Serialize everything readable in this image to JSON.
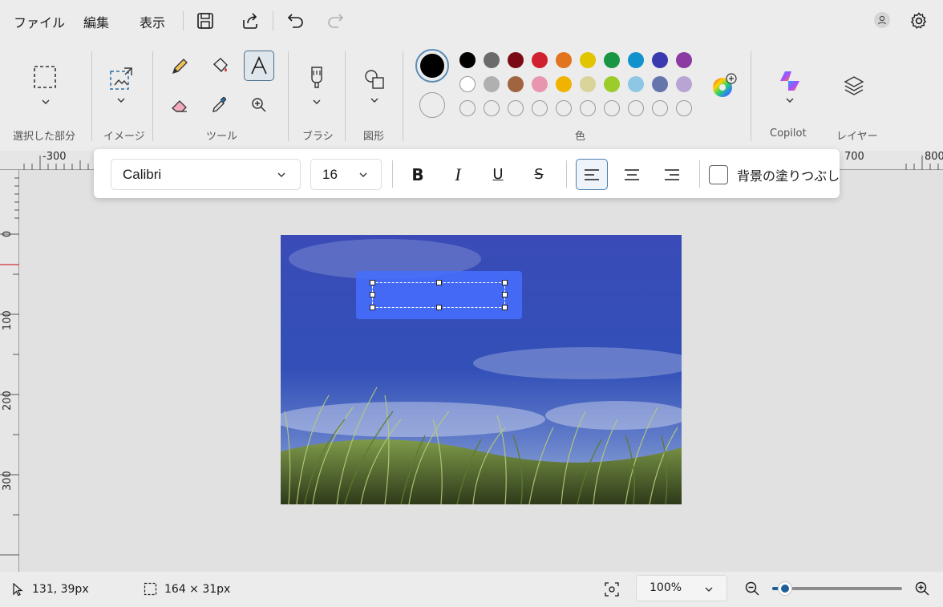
{
  "menu": {
    "file": "ファイル",
    "edit": "編集",
    "view": "表示"
  },
  "ribbon": {
    "selection_label": "選択した部分",
    "image_label": "イメージ",
    "tools_label": "ツール",
    "brush_label": "ブラシ",
    "shapes_label": "図形",
    "color_label": "色",
    "copilot_label": "Copilot",
    "layers_label": "レイヤー"
  },
  "colors": {
    "primary": "#000000",
    "secondary": "#ffffff",
    "palette_row1": [
      "#000000",
      "#6b6b6b",
      "#7a0b14",
      "#d1202f",
      "#e2731f",
      "#e3c400",
      "#1a9642",
      "#1292cc",
      "#3a3ab0",
      "#8a3aa0"
    ],
    "palette_row2": [
      "#ffffff",
      "#b0b0b0",
      "#a06540",
      "#e896b0",
      "#f0b300",
      "#d8d49a",
      "#9ccc2a",
      "#8ec7e3",
      "#6676ad",
      "#b8a5d3"
    ]
  },
  "rulers": {
    "h_labels": [
      "-300",
      "700",
      "800"
    ],
    "v_labels": [
      "0",
      "100",
      "200",
      "300"
    ]
  },
  "text_toolbar": {
    "font": "Calibri",
    "size": "16",
    "bold": "B",
    "italic": "I",
    "underline": "U",
    "strike": "S",
    "fill_background_label": "背景の塗りつぶし"
  },
  "status": {
    "cursor": "131, 39px",
    "selection_size": "164 × 31px",
    "zoom": "100%",
    "zoom_level": 0.1
  },
  "icons": {
    "save": "save-icon",
    "share": "share-icon",
    "undo": "undo-icon",
    "redo": "redo-icon",
    "account": "account-icon",
    "settings": "gear-icon"
  }
}
